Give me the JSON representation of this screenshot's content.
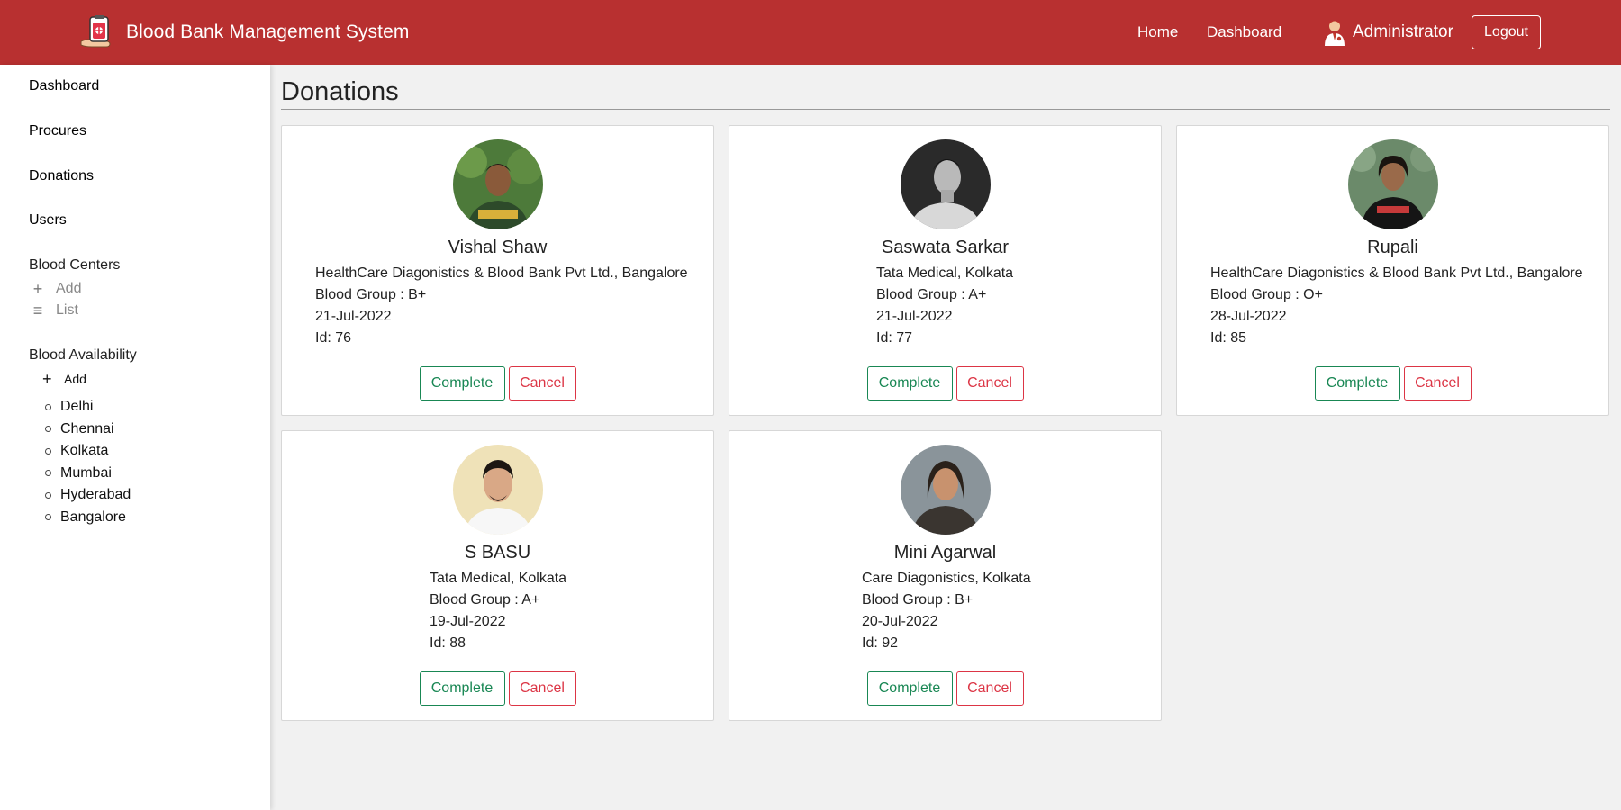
{
  "navbar": {
    "brand": "Blood Bank Management System",
    "home": "Home",
    "dashboard": "Dashboard",
    "user": "Administrator",
    "logout": "Logout",
    "brand_color": "#b83030"
  },
  "sidebar": {
    "dashboard": "Dashboard",
    "procures": "Procures",
    "donations": "Donations",
    "users": "Users",
    "blood_centers": {
      "heading": "Blood Centers",
      "add": "Add",
      "list": "List"
    },
    "blood_availability": {
      "heading": "Blood Availability",
      "add": "Add",
      "cities": [
        "Delhi",
        "Chennai",
        "Kolkata",
        "Mumbai",
        "Hyderabad",
        "Bangalore"
      ]
    }
  },
  "main": {
    "title": "Donations",
    "complete_label": "Complete",
    "cancel_label": "Cancel",
    "donations": [
      {
        "name": "Vishal Shaw",
        "center": "HealthCare Diagonistics & Blood Bank Pvt Ltd., Bangalore",
        "blood_group": "Blood Group : B+",
        "date": "21-Jul-2022",
        "id": "Id: 76"
      },
      {
        "name": "Saswata Sarkar",
        "center": "Tata Medical, Kolkata",
        "blood_group": "Blood Group : A+",
        "date": "21-Jul-2022",
        "id": "Id: 77"
      },
      {
        "name": "Rupali",
        "center": "HealthCare Diagonistics & Blood Bank Pvt Ltd., Bangalore",
        "blood_group": "Blood Group : O+",
        "date": "28-Jul-2022",
        "id": "Id: 85"
      },
      {
        "name": "S BASU",
        "center": "Tata Medical, Kolkata",
        "blood_group": "Blood Group : A+",
        "date": "19-Jul-2022",
        "id": "Id: 88"
      },
      {
        "name": "Mini Agarwal",
        "center": "Care Diagonistics, Kolkata",
        "blood_group": "Blood Group : B+",
        "date": "20-Jul-2022",
        "id": "Id: 92"
      }
    ]
  },
  "colors": {
    "complete": "#198754",
    "cancel": "#dc3545"
  }
}
